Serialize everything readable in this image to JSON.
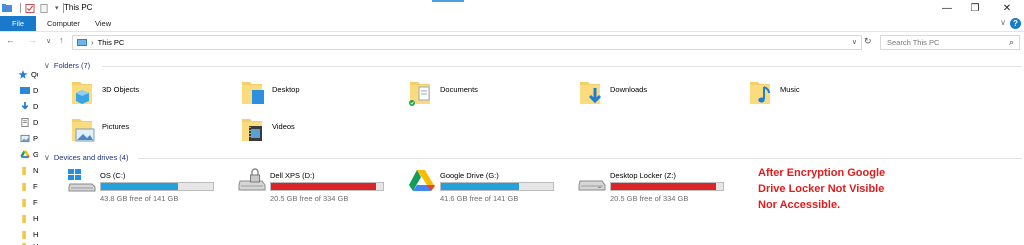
{
  "window": {
    "title": "This PC"
  },
  "ribbon": {
    "tabs": [
      "File",
      "Computer",
      "View"
    ]
  },
  "address": {
    "path": "This PC",
    "search_placeholder": "Search This PC"
  },
  "nav_pane": {
    "items": [
      {
        "label": "Qu",
        "icon": "star-icon"
      },
      {
        "label": "D",
        "icon": "desktop-icon"
      },
      {
        "label": "D",
        "icon": "download-icon"
      },
      {
        "label": "D",
        "icon": "document-icon"
      },
      {
        "label": "P",
        "icon": "picture-icon"
      },
      {
        "label": "G",
        "icon": "google-drive-icon"
      },
      {
        "label": "N",
        "icon": "folder-icon"
      },
      {
        "label": "F",
        "icon": "folder-icon"
      },
      {
        "label": "F",
        "icon": "folder-icon"
      },
      {
        "label": "H",
        "icon": "folder-icon"
      },
      {
        "label": "H",
        "icon": "folder-icon"
      },
      {
        "label": "H",
        "icon": "folder-icon"
      }
    ]
  },
  "folders": {
    "header": "Folders (7)",
    "items": [
      {
        "name": "3D Objects",
        "icon": "3d-objects-folder-icon"
      },
      {
        "name": "Desktop",
        "icon": "desktop-folder-icon"
      },
      {
        "name": "Documents",
        "icon": "documents-folder-icon"
      },
      {
        "name": "Downloads",
        "icon": "downloads-folder-icon"
      },
      {
        "name": "Music",
        "icon": "music-folder-icon"
      },
      {
        "name": "Pictures",
        "icon": "pictures-folder-icon"
      },
      {
        "name": "Videos",
        "icon": "videos-folder-icon"
      }
    ]
  },
  "drives": {
    "header": "Devices and drives (4)",
    "items": [
      {
        "name": "OS (C:)",
        "free": "43.8 GB free of 141 GB",
        "used_fraction": 0.69,
        "bar_color": "#26a0da",
        "icon": "windows-drive-icon"
      },
      {
        "name": "Dell XPS (D:)",
        "free": "20.5 GB free of 334 GB",
        "used_fraction": 0.94,
        "bar_color": "#da2626",
        "icon": "locked-drive-icon"
      },
      {
        "name": "Google Drive (G:)",
        "free": "41.6 GB free of 141 GB",
        "used_fraction": 0.7,
        "bar_color": "#26a0da",
        "icon": "google-drive-icon"
      },
      {
        "name": "Desktop Locker (Z:)",
        "free": "20.5 GB free of 334 GB",
        "used_fraction": 0.94,
        "bar_color": "#da2626",
        "icon": "drive-icon"
      }
    ]
  },
  "annotation": {
    "lines": [
      "After Encryption Google",
      "Drive Locker Not Visible",
      "Nor Accessible."
    ]
  }
}
